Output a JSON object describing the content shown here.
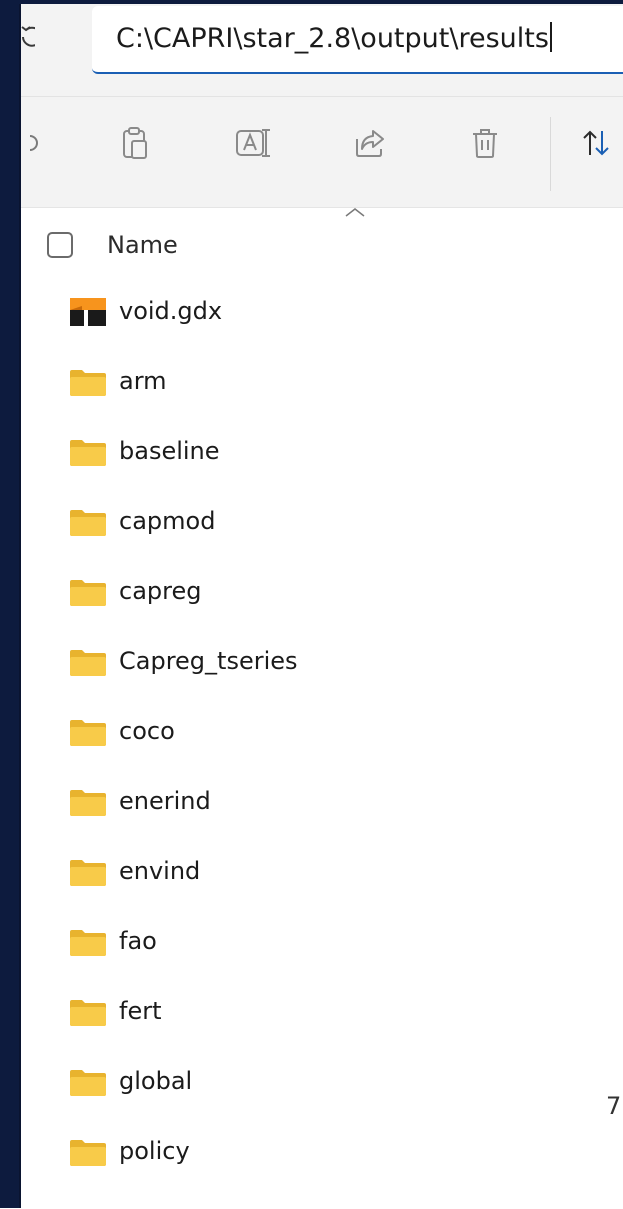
{
  "address_bar": {
    "path": "C:\\CAPRI\\star_2.8\\output\\results"
  },
  "toolbar": {
    "buttons": [
      {
        "name": "paste-icon"
      },
      {
        "name": "rename-icon"
      },
      {
        "name": "share-icon"
      },
      {
        "name": "delete-icon"
      },
      {
        "name": "sort-icon"
      }
    ]
  },
  "list": {
    "column_header": "Name",
    "files": [
      {
        "name": "void.gdx",
        "icon": "gdx-file-icon"
      },
      {
        "name": "arm",
        "icon": "folder-icon"
      },
      {
        "name": "baseline",
        "icon": "folder-icon"
      },
      {
        "name": "capmod",
        "icon": "folder-icon"
      },
      {
        "name": "capreg",
        "icon": "folder-icon"
      },
      {
        "name": "Capreg_tseries",
        "icon": "folder-icon"
      },
      {
        "name": "coco",
        "icon": "folder-icon"
      },
      {
        "name": "enerind",
        "icon": "folder-icon"
      },
      {
        "name": "envind",
        "icon": "folder-icon"
      },
      {
        "name": "fao",
        "icon": "folder-icon"
      },
      {
        "name": "fert",
        "icon": "folder-icon"
      },
      {
        "name": "global",
        "icon": "folder-icon"
      },
      {
        "name": "policy",
        "icon": "folder-icon"
      }
    ]
  },
  "page_marker": "7",
  "colors": {
    "folder": "#f5c63c",
    "gdx_orange": "#f7941d",
    "accent": "#1a5fb4"
  }
}
